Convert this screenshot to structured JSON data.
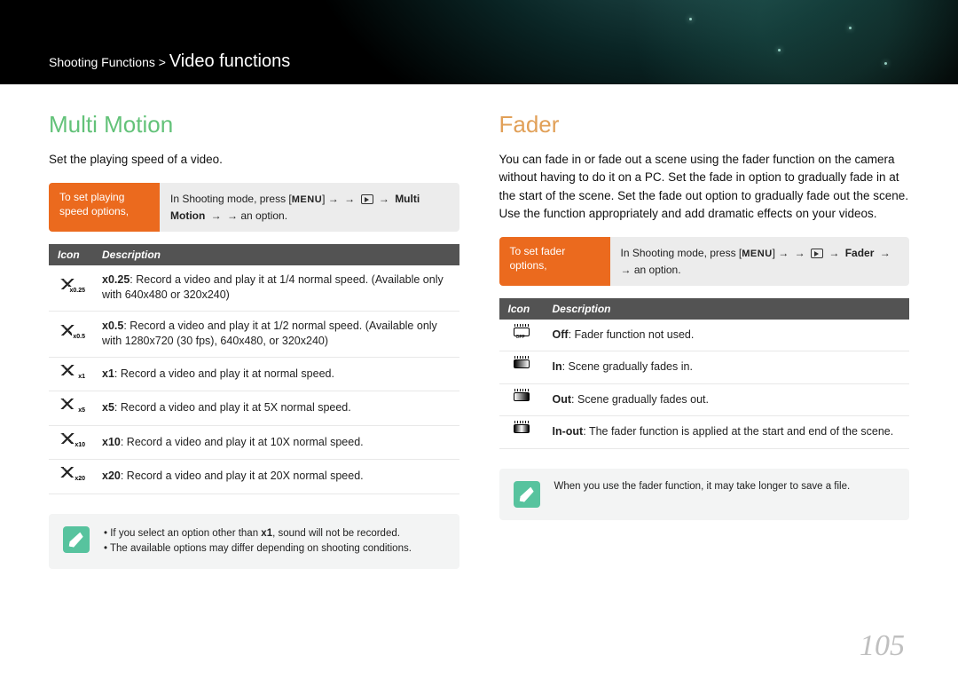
{
  "page_number": "105",
  "breadcrumb": {
    "parent": "Shooting Functions",
    "separator": ">",
    "current": "Video functions"
  },
  "left": {
    "title": "Multi Motion",
    "intro": "Set the playing speed of a video.",
    "instruction": {
      "label": "To set playing speed options,",
      "prefix": "In Shooting mode, press [",
      "menu": "MENU",
      "mid1": "] → ",
      "path1": "Multi Motion",
      "suffix": " → an option."
    },
    "headers": {
      "icon": "Icon",
      "desc": "Description"
    },
    "rows": [
      {
        "speed": "x0.25",
        "bold": "x0.25",
        "text": ": Record a video and play it at 1/4 normal speed. (Available only with 640x480 or 320x240)"
      },
      {
        "speed": "x0.5",
        "bold": "x0.5",
        "text": ": Record a video and play it at 1/2 normal speed. (Available only with 1280x720 (30 fps), 640x480, or 320x240)"
      },
      {
        "speed": "x1",
        "bold": "x1",
        "text": ": Record a video and play it at normal speed."
      },
      {
        "speed": "x5",
        "bold": "x5",
        "text": ": Record a video and play it at 5X normal speed."
      },
      {
        "speed": "x10",
        "bold": "x10",
        "text": ": Record a video and play it at 10X normal speed."
      },
      {
        "speed": "x20",
        "bold": "x20",
        "text": ": Record a video and play it at 20X normal speed."
      }
    ],
    "notes": [
      "If you select an option other than x1, sound will not be recorded.",
      "The available options may differ depending on shooting conditions."
    ],
    "note_bold": "x1"
  },
  "right": {
    "title": "Fader",
    "intro": "You can fade in or fade out a scene using the fader function on the camera without having to do it on a PC. Set the fade in option to gradually fade in at the start of the scene. Set the fade out option to gradually fade out the scene. Use the function appropriately and add dramatic effects on your videos.",
    "instruction": {
      "label": "To set fader options,",
      "prefix": "In Shooting mode, press [",
      "menu": "MENU",
      "mid1": "] → ",
      "path1": "Fader",
      "suffix": " → an option."
    },
    "headers": {
      "icon": "Icon",
      "desc": "Description"
    },
    "rows": [
      {
        "mode": "off",
        "bold": "Off",
        "text": ": Fader function not used."
      },
      {
        "mode": "in",
        "bold": "In",
        "text": ": Scene gradually fades in."
      },
      {
        "mode": "out",
        "bold": "Out",
        "text": ": Scene gradually fades out."
      },
      {
        "mode": "inout",
        "bold": "In-out",
        "text": ": The fader function is applied at the start and end of the scene."
      }
    ],
    "note": "When you use the fader function, it may take longer to save a file."
  }
}
